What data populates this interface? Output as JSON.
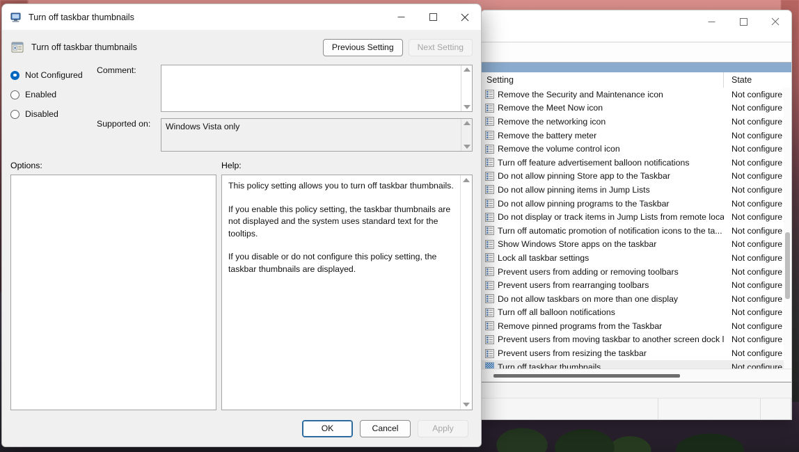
{
  "desktop": {
    "wallpaper_name": "sunset-landscape-wallpaper"
  },
  "background_window": {
    "title": "",
    "controls": {
      "minimize": "minimize-icon",
      "maximize": "maximize-icon",
      "close": "close-icon"
    },
    "columns": {
      "setting": "Setting",
      "state": "State"
    },
    "rows": [
      {
        "name": "Remove the Security and Maintenance icon",
        "state": "Not configure",
        "icon": "policy-icon",
        "selected": false
      },
      {
        "name": "Remove the Meet Now icon",
        "state": "Not configure",
        "icon": "policy-icon",
        "selected": false
      },
      {
        "name": "Remove the networking icon",
        "state": "Not configure",
        "icon": "policy-icon",
        "selected": false
      },
      {
        "name": "Remove the battery meter",
        "state": "Not configure",
        "icon": "policy-icon",
        "selected": false
      },
      {
        "name": "Remove the volume control icon",
        "state": "Not configure",
        "icon": "policy-icon",
        "selected": false
      },
      {
        "name": "Turn off feature advertisement balloon notifications",
        "state": "Not configure",
        "icon": "policy-icon",
        "selected": false
      },
      {
        "name": "Do not allow pinning Store app to the Taskbar",
        "state": "Not configure",
        "icon": "policy-icon",
        "selected": false
      },
      {
        "name": "Do not allow pinning items in Jump Lists",
        "state": "Not configure",
        "icon": "policy-icon",
        "selected": false
      },
      {
        "name": "Do not allow pinning programs to the Taskbar",
        "state": "Not configure",
        "icon": "policy-icon",
        "selected": false
      },
      {
        "name": "Do not display or track items in Jump Lists from remote loca...",
        "state": "Not configure",
        "icon": "policy-icon",
        "selected": false
      },
      {
        "name": "Turn off automatic promotion of notification icons to the ta...",
        "state": "Not configure",
        "icon": "policy-icon",
        "selected": false
      },
      {
        "name": "Show Windows Store apps on the taskbar",
        "state": "Not configure",
        "icon": "policy-icon",
        "selected": false
      },
      {
        "name": "Lock all taskbar settings",
        "state": "Not configure",
        "icon": "policy-icon",
        "selected": false
      },
      {
        "name": "Prevent users from adding or removing toolbars",
        "state": "Not configure",
        "icon": "policy-icon",
        "selected": false
      },
      {
        "name": "Prevent users from rearranging toolbars",
        "state": "Not configure",
        "icon": "policy-icon",
        "selected": false
      },
      {
        "name": "Do not allow taskbars on more than one display",
        "state": "Not configure",
        "icon": "policy-icon",
        "selected": false
      },
      {
        "name": "Turn off all balloon notifications",
        "state": "Not configure",
        "icon": "policy-icon",
        "selected": false
      },
      {
        "name": "Remove pinned programs from the Taskbar",
        "state": "Not configure",
        "icon": "policy-icon",
        "selected": false
      },
      {
        "name": "Prevent users from moving taskbar to another screen dock l...",
        "state": "Not configure",
        "icon": "policy-icon",
        "selected": false
      },
      {
        "name": "Prevent users from resizing the taskbar",
        "state": "Not configure",
        "icon": "policy-icon",
        "selected": false
      },
      {
        "name": "Turn off taskbar thumbnails",
        "state": "Not configure",
        "icon": "selected-policy-icon",
        "selected": true
      }
    ]
  },
  "dialog": {
    "titlebar": {
      "title": "Turn off taskbar thumbnails",
      "icon": "policy-monitor-icon",
      "minimize": "minimize-icon",
      "maximize": "maximize-icon",
      "close": "close-icon"
    },
    "header": {
      "icon": "policy-document-icon",
      "title": "Turn off taskbar thumbnails",
      "previous_setting": "Previous Setting",
      "next_setting": "Next Setting"
    },
    "state_options": [
      {
        "label": "Not Configured",
        "checked": true
      },
      {
        "label": "Enabled",
        "checked": false
      },
      {
        "label": "Disabled",
        "checked": false
      }
    ],
    "comment": {
      "label": "Comment:",
      "value": "",
      "placeholder": ""
    },
    "supported_on": {
      "label": "Supported on:",
      "value": "Windows Vista only"
    },
    "options": {
      "label": "Options:",
      "value": ""
    },
    "help": {
      "label": "Help:",
      "paragraphs": [
        "This policy setting allows you to turn off taskbar thumbnails.",
        "If you enable this policy setting, the taskbar thumbnails are not displayed and the system uses standard text for the tooltips.",
        "If you disable or do not configure this policy setting, the taskbar thumbnails are displayed."
      ]
    },
    "footer": {
      "ok": "OK",
      "cancel": "Cancel",
      "apply": "Apply",
      "apply_disabled": true
    }
  },
  "colors": {
    "accent": "#0067c0",
    "selection_band": "#8aabcd",
    "row_selected": "#ededed",
    "dialog_bg": "#f0f0f0"
  }
}
